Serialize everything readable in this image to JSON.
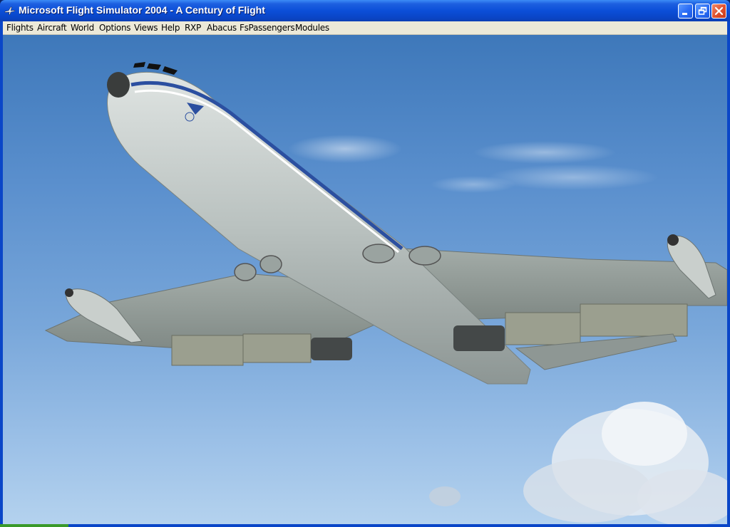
{
  "window": {
    "title": "Microsoft Flight Simulator 2004 - A Century of Flight"
  },
  "menu": {
    "items": [
      "Flights",
      "Aircraft",
      "World",
      "Options",
      "Views",
      "Help",
      "RXP",
      "Abacus",
      "FsPassengers",
      "Modules"
    ]
  },
  "colors": {
    "titlebar": "#0b4fd8",
    "menubar": "#ece9d8",
    "sky_top": "#3e78ba",
    "sky_bottom": "#b4d2ee",
    "fuselage": "#c5cbc9",
    "cheatline": "#2b4fa0"
  },
  "icons": {
    "app": "plane-icon",
    "minimize": "minimize-icon",
    "restore": "restore-icon",
    "close": "close-icon"
  }
}
